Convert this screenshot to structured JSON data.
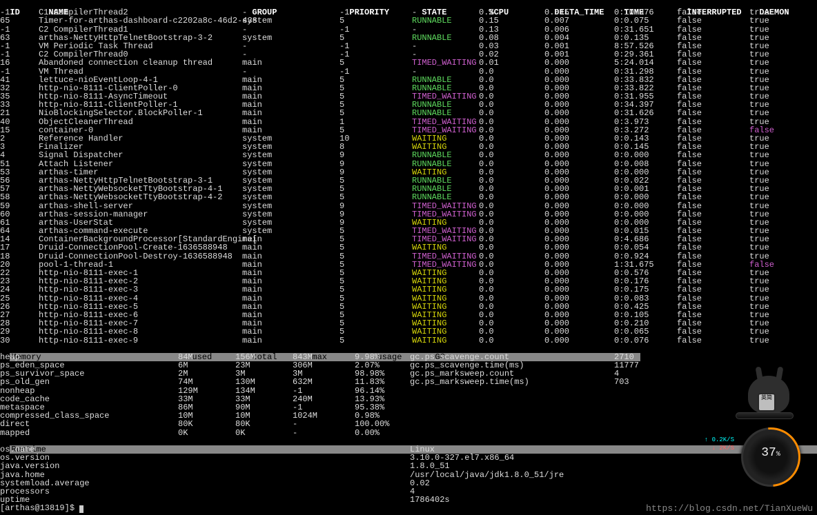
{
  "headers": {
    "id": "ID",
    "name": "NAME",
    "group": "GROUP",
    "priority": "PRIORITY",
    "state": "STATE",
    "cpu": "%CPU",
    "delta_time": "DELTA_TIME",
    "time": "TIME",
    "interrupted": "INTERRUPTED",
    "daemon": "DAEMON"
  },
  "threads": [
    {
      "id": "-1",
      "name": "C1 CompilerThread2",
      "group": "-",
      "priority": "-1",
      "state": "-",
      "cpu": "0.3",
      "dt": "0.015",
      "time": "0:10.976",
      "int": "false",
      "daemon": "true"
    },
    {
      "id": "65",
      "name": "Timer-for-arthas-dashboard-c2202a8c-46d2-438",
      "group": "system",
      "priority": "5",
      "state": "RUNNABLE",
      "cpu": "0.15",
      "dt": "0.007",
      "time": "0:0.075",
      "int": "false",
      "daemon": "true"
    },
    {
      "id": "-1",
      "name": "C2 CompilerThread1",
      "group": "-",
      "priority": "-1",
      "state": "-",
      "cpu": "0.13",
      "dt": "0.006",
      "time": "0:31.651",
      "int": "false",
      "daemon": "true"
    },
    {
      "id": "63",
      "name": "arthas-NettyHttpTelnetBootstrap-3-2",
      "group": "system",
      "priority": "5",
      "state": "RUNNABLE",
      "cpu": "0.08",
      "dt": "0.004",
      "time": "0:0.135",
      "int": "false",
      "daemon": "true"
    },
    {
      "id": "-1",
      "name": "VM Periodic Task Thread",
      "group": "-",
      "priority": "-1",
      "state": "-",
      "cpu": "0.03",
      "dt": "0.001",
      "time": "8:57.526",
      "int": "false",
      "daemon": "true"
    },
    {
      "id": "-1",
      "name": "C2 CompilerThread0",
      "group": "-",
      "priority": "-1",
      "state": "-",
      "cpu": "0.02",
      "dt": "0.001",
      "time": "0:29.361",
      "int": "false",
      "daemon": "true"
    },
    {
      "id": "16",
      "name": "Abandoned connection cleanup thread",
      "group": "main",
      "priority": "5",
      "state": "TIMED_WAITING",
      "cpu": "0.01",
      "dt": "0.000",
      "time": "5:24.014",
      "int": "false",
      "daemon": "true"
    },
    {
      "id": "-1",
      "name": "VM Thread",
      "group": "-",
      "priority": "-1",
      "state": "-",
      "cpu": "0.0",
      "dt": "0.000",
      "time": "0:31.298",
      "int": "false",
      "daemon": "true"
    },
    {
      "id": "41",
      "name": "lettuce-nioEventLoop-4-1",
      "group": "main",
      "priority": "5",
      "state": "RUNNABLE",
      "cpu": "0.0",
      "dt": "0.000",
      "time": "0:33.832",
      "int": "false",
      "daemon": "true"
    },
    {
      "id": "32",
      "name": "http-nio-8111-ClientPoller-0",
      "group": "main",
      "priority": "5",
      "state": "RUNNABLE",
      "cpu": "0.0",
      "dt": "0.000",
      "time": "0:33.822",
      "int": "false",
      "daemon": "true"
    },
    {
      "id": "35",
      "name": "http-nio-8111-AsyncTimeout",
      "group": "main",
      "priority": "5",
      "state": "TIMED_WAITING",
      "cpu": "0.0",
      "dt": "0.000",
      "time": "0:31.955",
      "int": "false",
      "daemon": "true"
    },
    {
      "id": "33",
      "name": "http-nio-8111-ClientPoller-1",
      "group": "main",
      "priority": "5",
      "state": "RUNNABLE",
      "cpu": "0.0",
      "dt": "0.000",
      "time": "0:34.397",
      "int": "false",
      "daemon": "true"
    },
    {
      "id": "21",
      "name": "NioBlockingSelector.BlockPoller-1",
      "group": "main",
      "priority": "5",
      "state": "RUNNABLE",
      "cpu": "0.0",
      "dt": "0.000",
      "time": "0:31.626",
      "int": "false",
      "daemon": "true"
    },
    {
      "id": "40",
      "name": "ObjectCleanerThread",
      "group": "main",
      "priority": "1",
      "state": "TIMED_WAITING",
      "cpu": "0.0",
      "dt": "0.000",
      "time": "0:3.973",
      "int": "false",
      "daemon": "true"
    },
    {
      "id": "15",
      "name": "container-0",
      "group": "main",
      "priority": "5",
      "state": "TIMED_WAITING",
      "cpu": "0.0",
      "dt": "0.000",
      "time": "0:3.272",
      "int": "false",
      "daemon": "false",
      "daemonPink": true
    },
    {
      "id": "2",
      "name": "Reference Handler",
      "group": "system",
      "priority": "10",
      "state": "WAITING",
      "cpu": "0.0",
      "dt": "0.000",
      "time": "0:0.143",
      "int": "false",
      "daemon": "true"
    },
    {
      "id": "3",
      "name": "Finalizer",
      "group": "system",
      "priority": "8",
      "state": "WAITING",
      "cpu": "0.0",
      "dt": "0.000",
      "time": "0:0.145",
      "int": "false",
      "daemon": "true"
    },
    {
      "id": "4",
      "name": "Signal Dispatcher",
      "group": "system",
      "priority": "9",
      "state": "RUNNABLE",
      "cpu": "0.0",
      "dt": "0.000",
      "time": "0:0.000",
      "int": "false",
      "daemon": "true"
    },
    {
      "id": "51",
      "name": "Attach Listener",
      "group": "system",
      "priority": "9",
      "state": "RUNNABLE",
      "cpu": "0.0",
      "dt": "0.000",
      "time": "0:0.008",
      "int": "false",
      "daemon": "true"
    },
    {
      "id": "53",
      "name": "arthas-timer",
      "group": "system",
      "priority": "9",
      "state": "WAITING",
      "cpu": "0.0",
      "dt": "0.000",
      "time": "0:0.000",
      "int": "false",
      "daemon": "true"
    },
    {
      "id": "56",
      "name": "arthas-NettyHttpTelnetBootstrap-3-1",
      "group": "system",
      "priority": "5",
      "state": "RUNNABLE",
      "cpu": "0.0",
      "dt": "0.000",
      "time": "0:0.022",
      "int": "false",
      "daemon": "true"
    },
    {
      "id": "57",
      "name": "arthas-NettyWebsocketTtyBootstrap-4-1",
      "group": "system",
      "priority": "5",
      "state": "RUNNABLE",
      "cpu": "0.0",
      "dt": "0.000",
      "time": "0:0.001",
      "int": "false",
      "daemon": "true"
    },
    {
      "id": "58",
      "name": "arthas-NettyWebsocketTtyBootstrap-4-2",
      "group": "system",
      "priority": "5",
      "state": "RUNNABLE",
      "cpu": "0.0",
      "dt": "0.000",
      "time": "0:0.000",
      "int": "false",
      "daemon": "true"
    },
    {
      "id": "59",
      "name": "arthas-shell-server",
      "group": "system",
      "priority": "9",
      "state": "TIMED_WAITING",
      "cpu": "0.0",
      "dt": "0.000",
      "time": "0:0.000",
      "int": "false",
      "daemon": "true"
    },
    {
      "id": "60",
      "name": "arthas-session-manager",
      "group": "system",
      "priority": "9",
      "state": "TIMED_WAITING",
      "cpu": "0.0",
      "dt": "0.000",
      "time": "0:0.000",
      "int": "false",
      "daemon": "true"
    },
    {
      "id": "61",
      "name": "arthas-UserStat",
      "group": "system",
      "priority": "9",
      "state": "WAITING",
      "cpu": "0.0",
      "dt": "0.000",
      "time": "0:0.000",
      "int": "false",
      "daemon": "true"
    },
    {
      "id": "64",
      "name": "arthas-command-execute",
      "group": "system",
      "priority": "5",
      "state": "TIMED_WAITING",
      "cpu": "0.0",
      "dt": "0.000",
      "time": "0:0.015",
      "int": "false",
      "daemon": "true"
    },
    {
      "id": "14",
      "name": "ContainerBackgroundProcessor[StandardEngine[",
      "group": "main",
      "priority": "5",
      "state": "TIMED_WAITING",
      "cpu": "0.0",
      "dt": "0.000",
      "time": "0:4.686",
      "int": "false",
      "daemon": "true"
    },
    {
      "id": "17",
      "name": "Druid-ConnectionPool-Create-1636588948",
      "group": "main",
      "priority": "5",
      "state": "WAITING",
      "cpu": "0.0",
      "dt": "0.000",
      "time": "0:0.054",
      "int": "false",
      "daemon": "true"
    },
    {
      "id": "18",
      "name": "Druid-ConnectionPool-Destroy-1636588948",
      "group": "main",
      "priority": "5",
      "state": "TIMED_WAITING",
      "cpu": "0.0",
      "dt": "0.000",
      "time": "0:0.924",
      "int": "false",
      "daemon": "true"
    },
    {
      "id": "20",
      "name": "pool-1-thread-1",
      "group": "main",
      "priority": "5",
      "state": "TIMED_WAITING",
      "cpu": "0.0",
      "dt": "0.000",
      "time": "1:31.675",
      "int": "false",
      "daemon": "false",
      "daemonPink": true
    },
    {
      "id": "22",
      "name": "http-nio-8111-exec-1",
      "group": "main",
      "priority": "5",
      "state": "WAITING",
      "cpu": "0.0",
      "dt": "0.000",
      "time": "0:0.576",
      "int": "false",
      "daemon": "true"
    },
    {
      "id": "23",
      "name": "http-nio-8111-exec-2",
      "group": "main",
      "priority": "5",
      "state": "WAITING",
      "cpu": "0.0",
      "dt": "0.000",
      "time": "0:0.176",
      "int": "false",
      "daemon": "true"
    },
    {
      "id": "24",
      "name": "http-nio-8111-exec-3",
      "group": "main",
      "priority": "5",
      "state": "WAITING",
      "cpu": "0.0",
      "dt": "0.000",
      "time": "0:0.175",
      "int": "false",
      "daemon": "true"
    },
    {
      "id": "25",
      "name": "http-nio-8111-exec-4",
      "group": "main",
      "priority": "5",
      "state": "WAITING",
      "cpu": "0.0",
      "dt": "0.000",
      "time": "0:0.083",
      "int": "false",
      "daemon": "true"
    },
    {
      "id": "26",
      "name": "http-nio-8111-exec-5",
      "group": "main",
      "priority": "5",
      "state": "WAITING",
      "cpu": "0.0",
      "dt": "0.000",
      "time": "0:0.425",
      "int": "false",
      "daemon": "true"
    },
    {
      "id": "27",
      "name": "http-nio-8111-exec-6",
      "group": "main",
      "priority": "5",
      "state": "WAITING",
      "cpu": "0.0",
      "dt": "0.000",
      "time": "0:0.105",
      "int": "false",
      "daemon": "true"
    },
    {
      "id": "28",
      "name": "http-nio-8111-exec-7",
      "group": "main",
      "priority": "5",
      "state": "WAITING",
      "cpu": "0.0",
      "dt": "0.000",
      "time": "0:0.210",
      "int": "false",
      "daemon": "true"
    },
    {
      "id": "29",
      "name": "http-nio-8111-exec-8",
      "group": "main",
      "priority": "5",
      "state": "WAITING",
      "cpu": "0.0",
      "dt": "0.000",
      "time": "0:0.065",
      "int": "false",
      "daemon": "true"
    },
    {
      "id": "30",
      "name": "http-nio-8111-exec-9",
      "group": "main",
      "priority": "5",
      "state": "WAITING",
      "cpu": "0.0",
      "dt": "0.000",
      "time": "0:0.076",
      "int": "false",
      "daemon": "true"
    }
  ],
  "mem_section": {
    "header": {
      "a": "Memory",
      "b": "used",
      "c": "total",
      "d": "max",
      "e": "usage",
      "f": "GC",
      "g": ""
    },
    "rows": [
      {
        "a": "heap",
        "b": "84M",
        "c": "156M",
        "d": "843M",
        "e": "9.98%",
        "f": "gc.ps_scavenge.count",
        "g": "2710"
      },
      {
        "a": "ps_eden_space",
        "b": "6M",
        "c": "23M",
        "d": "306M",
        "e": "2.07%",
        "f": "gc.ps_scavenge.time(ms)",
        "g": "11777"
      },
      {
        "a": "ps_survivor_space",
        "b": "2M",
        "c": "3M",
        "d": "3M",
        "e": "98.98%",
        "f": "gc.ps_marksweep.count",
        "g": "4"
      },
      {
        "a": "ps_old_gen",
        "b": "74M",
        "c": "130M",
        "d": "632M",
        "e": "11.83%",
        "f": "gc.ps_marksweep.time(ms)",
        "g": "703"
      },
      {
        "a": "nonheap",
        "b": "129M",
        "c": "134M",
        "d": "-1",
        "e": "96.14%",
        "f": "",
        "g": ""
      },
      {
        "a": "code_cache",
        "b": "33M",
        "c": "33M",
        "d": "240M",
        "e": "13.93%",
        "f": "",
        "g": ""
      },
      {
        "a": "metaspace",
        "b": "86M",
        "c": "90M",
        "d": "-1",
        "e": "95.38%",
        "f": "",
        "g": ""
      },
      {
        "a": "compressed_class_space",
        "b": "10M",
        "c": "10M",
        "d": "1024M",
        "e": "0.98%",
        "f": "",
        "g": ""
      },
      {
        "a": "direct",
        "b": "80K",
        "c": "80K",
        "d": "-",
        "e": "100.00%",
        "f": "",
        "g": ""
      },
      {
        "a": "mapped",
        "b": "0K",
        "c": "0K",
        "d": "-",
        "e": "0.00%",
        "f": "",
        "g": ""
      }
    ]
  },
  "runtime": {
    "title": "Runtime",
    "rows": [
      {
        "k": "os.name",
        "v": "Linux"
      },
      {
        "k": "os.version",
        "v": "3.10.0-327.el7.x86_64"
      },
      {
        "k": "java.version",
        "v": "1.8.0_51"
      },
      {
        "k": "java.home",
        "v": "/usr/local/java/jdk1.8.0_51/jre"
      },
      {
        "k": "systemload.average",
        "v": "0.02"
      },
      {
        "k": "processors",
        "v": "4"
      },
      {
        "k": "uptime",
        "v": "1786402s"
      }
    ]
  },
  "prompt": "[arthas@13819]$ ",
  "watermark": "https://blog.csdn.net/TianXueWu",
  "gauge": {
    "value": "37",
    "unit": "%",
    "up": "↑ 0.2K/S",
    "dn": "↓ 2K/S"
  },
  "avatar_badge": "英简"
}
